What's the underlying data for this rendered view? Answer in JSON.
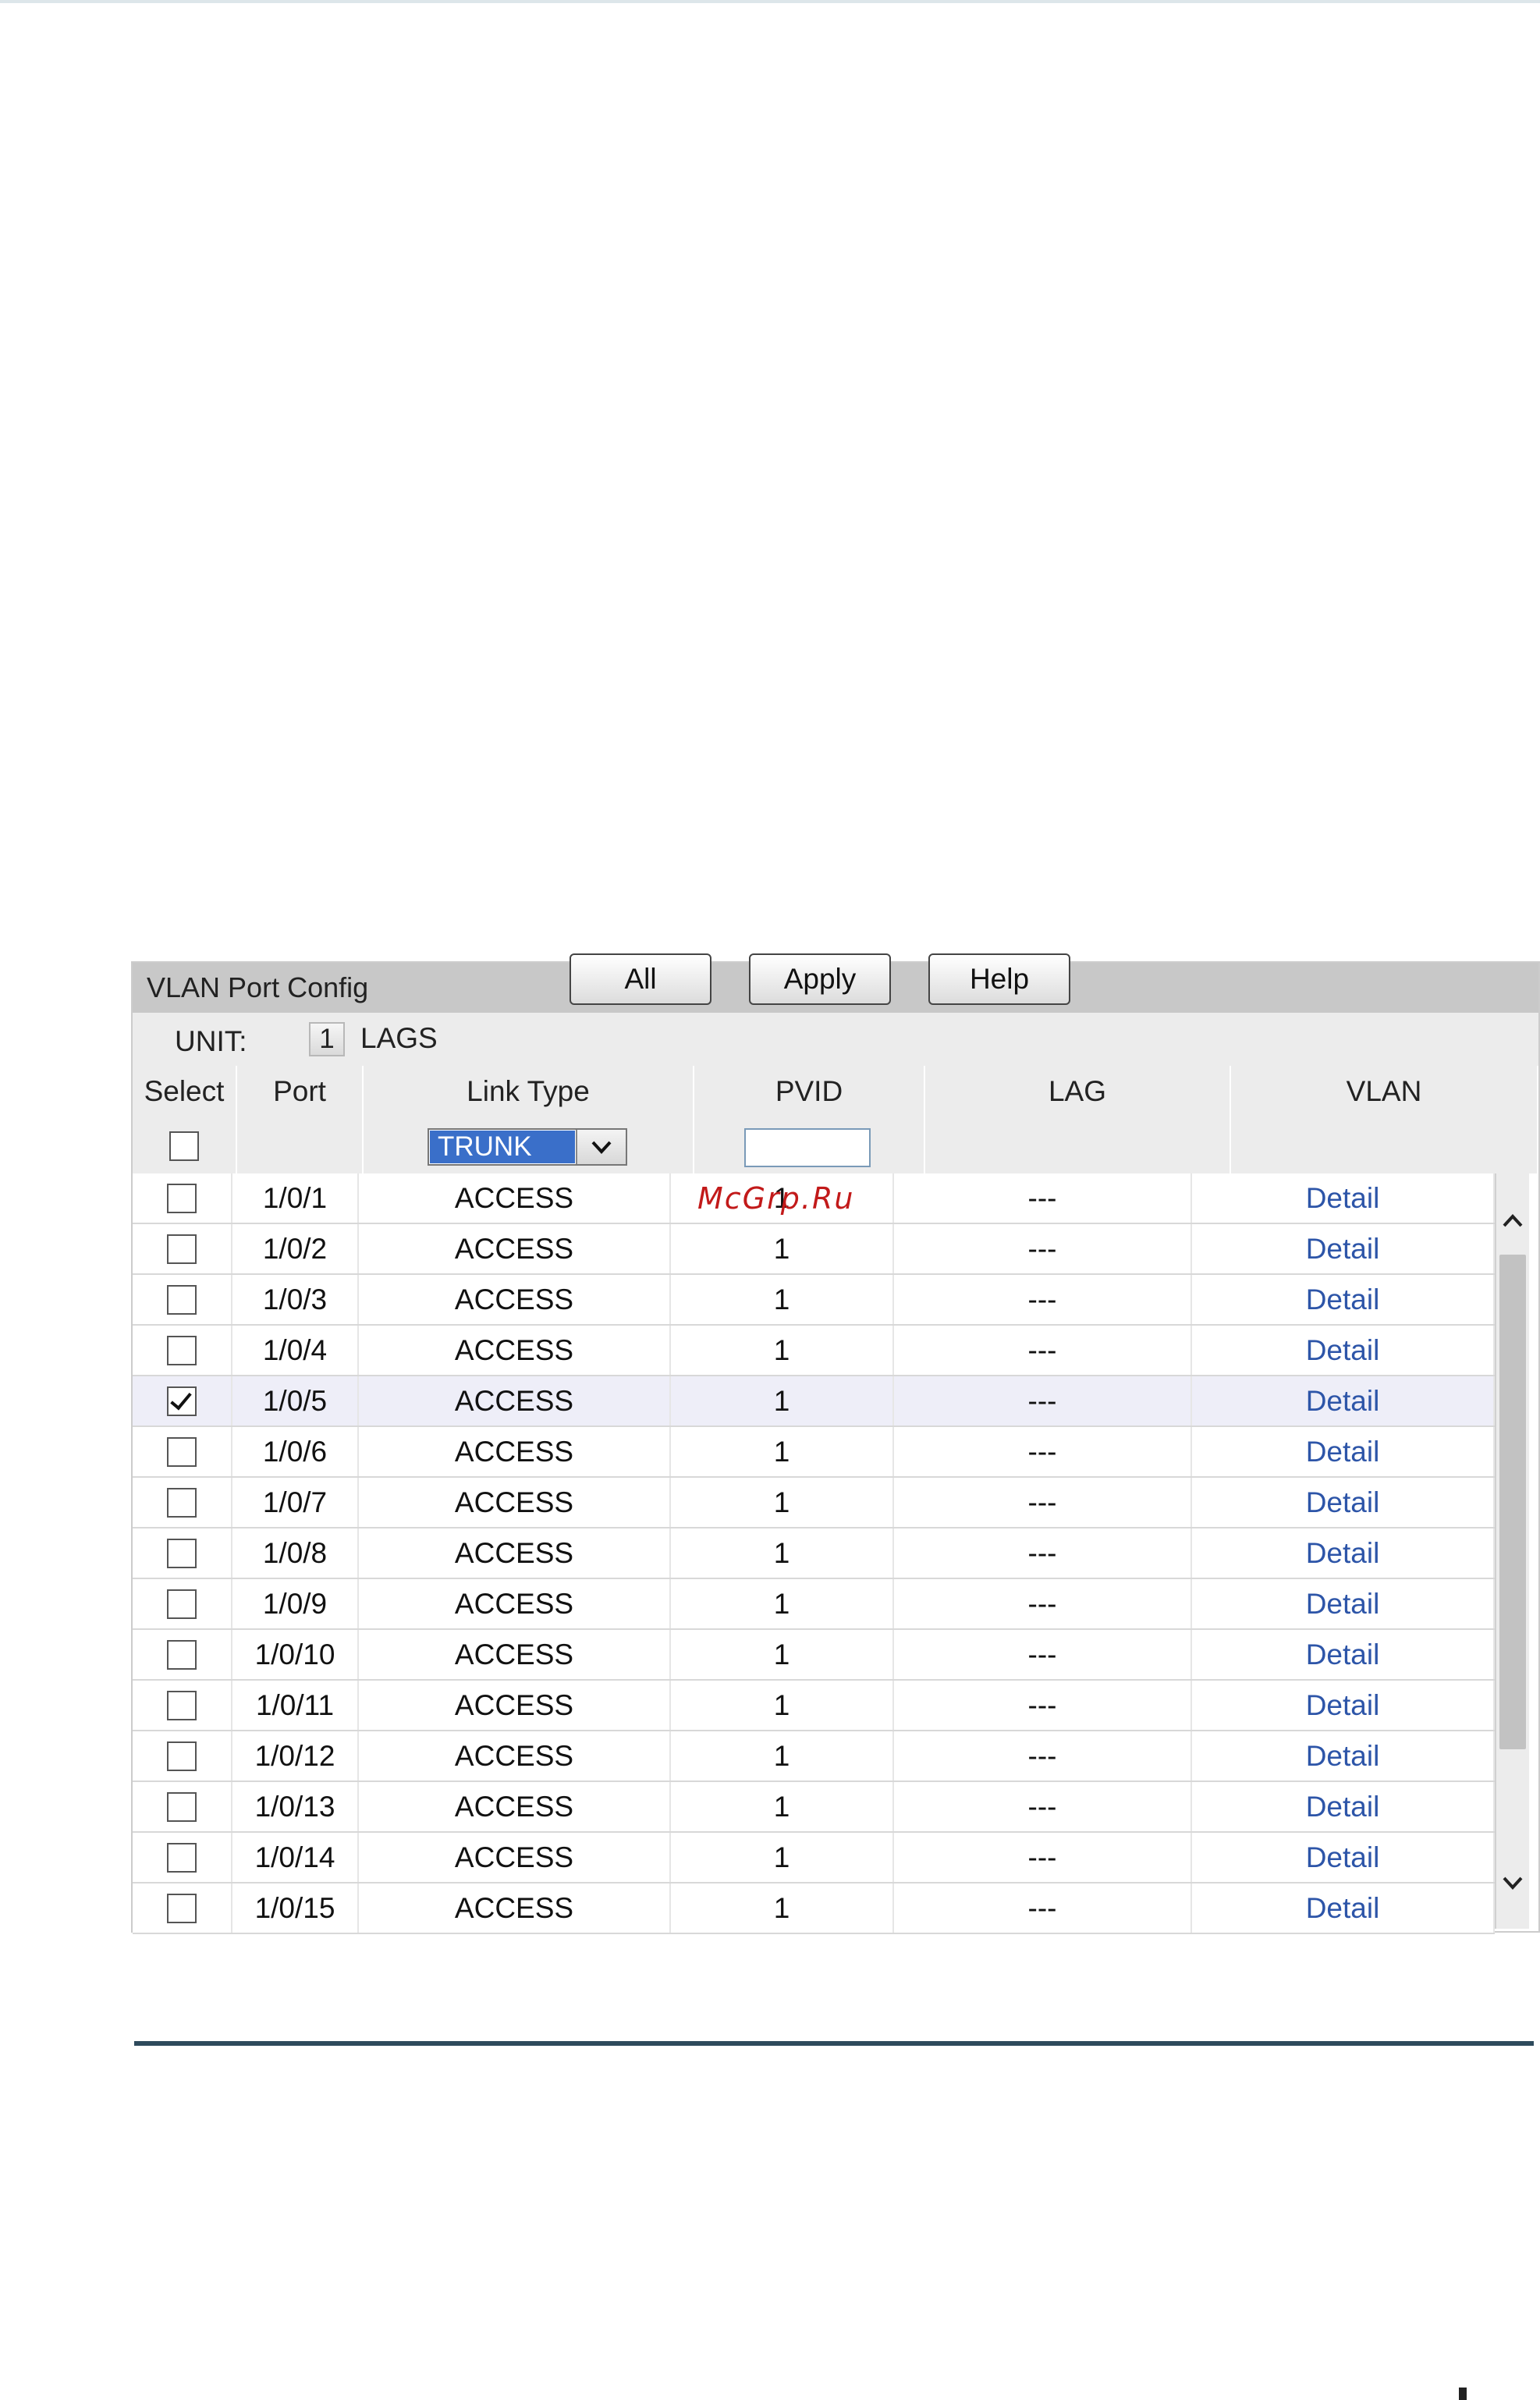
{
  "panel": {
    "title": "VLAN Port Config"
  },
  "unit": {
    "label": "UNIT:",
    "value": "1",
    "lags_label": "LAGS"
  },
  "columns": [
    "Select",
    "Port",
    "Link Type",
    "PVID",
    "LAG",
    "VLAN"
  ],
  "filter": {
    "link_type_value": "TRUNK",
    "pvid_value": ""
  },
  "rows": [
    {
      "port": "1/0/1",
      "link_type": "ACCESS",
      "pvid": "1",
      "lag": "---",
      "vlan": "Detail",
      "checked": false
    },
    {
      "port": "1/0/2",
      "link_type": "ACCESS",
      "pvid": "1",
      "lag": "---",
      "vlan": "Detail",
      "checked": false
    },
    {
      "port": "1/0/3",
      "link_type": "ACCESS",
      "pvid": "1",
      "lag": "---",
      "vlan": "Detail",
      "checked": false
    },
    {
      "port": "1/0/4",
      "link_type": "ACCESS",
      "pvid": "1",
      "lag": "---",
      "vlan": "Detail",
      "checked": false
    },
    {
      "port": "1/0/5",
      "link_type": "ACCESS",
      "pvid": "1",
      "lag": "---",
      "vlan": "Detail",
      "checked": true
    },
    {
      "port": "1/0/6",
      "link_type": "ACCESS",
      "pvid": "1",
      "lag": "---",
      "vlan": "Detail",
      "checked": false
    },
    {
      "port": "1/0/7",
      "link_type": "ACCESS",
      "pvid": "1",
      "lag": "---",
      "vlan": "Detail",
      "checked": false
    },
    {
      "port": "1/0/8",
      "link_type": "ACCESS",
      "pvid": "1",
      "lag": "---",
      "vlan": "Detail",
      "checked": false
    },
    {
      "port": "1/0/9",
      "link_type": "ACCESS",
      "pvid": "1",
      "lag": "---",
      "vlan": "Detail",
      "checked": false
    },
    {
      "port": "1/0/10",
      "link_type": "ACCESS",
      "pvid": "1",
      "lag": "---",
      "vlan": "Detail",
      "checked": false
    },
    {
      "port": "1/0/11",
      "link_type": "ACCESS",
      "pvid": "1",
      "lag": "---",
      "vlan": "Detail",
      "checked": false
    },
    {
      "port": "1/0/12",
      "link_type": "ACCESS",
      "pvid": "1",
      "lag": "---",
      "vlan": "Detail",
      "checked": false
    },
    {
      "port": "1/0/13",
      "link_type": "ACCESS",
      "pvid": "1",
      "lag": "---",
      "vlan": "Detail",
      "checked": false
    },
    {
      "port": "1/0/14",
      "link_type": "ACCESS",
      "pvid": "1",
      "lag": "---",
      "vlan": "Detail",
      "checked": false
    },
    {
      "port": "1/0/15",
      "link_type": "ACCESS",
      "pvid": "1",
      "lag": "---",
      "vlan": "Detail",
      "checked": false
    }
  ],
  "buttons": {
    "all": "All",
    "apply": "Apply",
    "help": "Help"
  },
  "watermark": "McGrp.Ru",
  "colors": {
    "header_bg": "#c8c8c8",
    "subheader_bg": "#ececec",
    "link": "#2d55a8",
    "selected_row": "#eeeef8",
    "rule": "#2e4a5c",
    "select_highlight": "#3a6fc9"
  }
}
